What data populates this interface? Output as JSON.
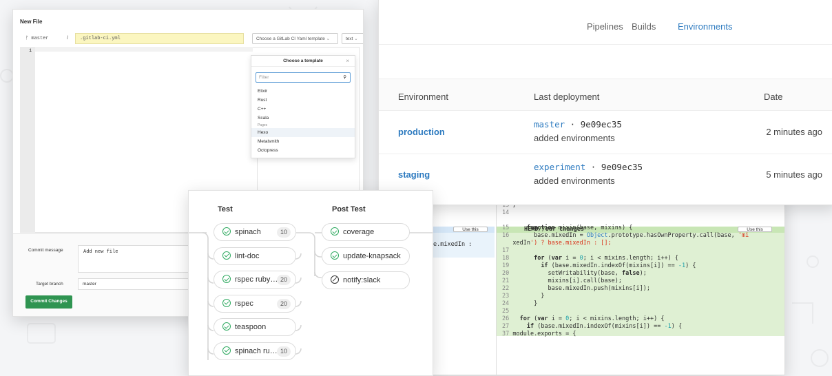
{
  "new_file": {
    "title": "New File",
    "branch": "master",
    "path_sep": "/",
    "file_name": ".gitlab-ci.yml",
    "template_button": "Choose a GitLab CI Yaml template",
    "text_button": "text",
    "line_number": "1",
    "dropdown": {
      "header": "Choose a template",
      "close": "×",
      "filter_placeholder": "Filter",
      "items": [
        "Elixir",
        "Rust",
        "C++",
        "Scala"
      ],
      "group": "Pages",
      "group_items": [
        "Hexo",
        "Metalsmith",
        "Octopress"
      ]
    },
    "commit_message_label": "Commit message",
    "commit_message_value": "Add new file",
    "target_branch_label": "Target branch",
    "target_branch_value": "master",
    "commit_button": "Commit Changes"
  },
  "environments": {
    "nav": [
      "Pipelines",
      "Builds",
      "Environments"
    ],
    "headers": [
      "Environment",
      "Last deployment",
      "Date"
    ],
    "rows": [
      {
        "name": "production",
        "branch": "master",
        "sha": "9e09ec35",
        "message": "added environments",
        "date": "2 minutes ago"
      },
      {
        "name": "staging",
        "branch": "experiment",
        "sha": "9e09ec35",
        "message": "added environments",
        "date": "5 minutes ago"
      }
    ]
  },
  "pipeline": {
    "stages": [
      "Test",
      "Post Test"
    ],
    "test_jobs": [
      {
        "name": "spinach",
        "count": "10"
      },
      {
        "name": "lint-doc",
        "count": ""
      },
      {
        "name": "rspec ruby…",
        "count": "20"
      },
      {
        "name": "rspec",
        "count": "20"
      },
      {
        "name": "teaspoon",
        "count": ""
      },
      {
        "name": "spinach ru…",
        "count": "10"
      }
    ],
    "post_jobs": [
      {
        "name": "coverage",
        "status": "success"
      },
      {
        "name": "update-knapsack",
        "status": "success"
      },
      {
        "name": "notify:slack",
        "status": "skipped"
      }
    ]
  },
  "diff": {
    "use_this": "Use this",
    "head_label": "HEAD//our changes",
    "left_line": "e.mixedIn :",
    "lines": [
      {
        "n": "13",
        "t": "}"
      },
      {
        "n": "14",
        "t": ""
      },
      {
        "n": "15",
        "t": "    function mixin(base, mixins) {"
      },
      {
        "n": "16",
        "t": "      base.mixedIn = Object.prototype.hasOwnProperty.call(base, 'mi"
      },
      {
        "n": "",
        "t": "xedIn') ? base.mixedIn : [];"
      },
      {
        "n": "17",
        "t": ""
      },
      {
        "n": "18",
        "t": "      for (var i = 0; i < mixins.length; i++) {"
      },
      {
        "n": "19",
        "t": "        if (base.mixedIn.indexOf(mixins[i]) == -1) {"
      },
      {
        "n": "20",
        "t": "          setWritability(base, false);"
      },
      {
        "n": "21",
        "t": "          mixins[i].call(base);"
      },
      {
        "n": "22",
        "t": "          base.mixedIn.push(mixins[i]);"
      },
      {
        "n": "23",
        "t": "        }"
      },
      {
        "n": "24",
        "t": "      }"
      },
      {
        "n": "25",
        "t": ""
      },
      {
        "n": "26",
        "t": "  for (var i = 0; i < mixins.length; i++) {"
      },
      {
        "n": "27",
        "t": "    if (base.mixedIn.indexOf(mixins[i]) == -1) {"
      },
      {
        "n": "37",
        "t": "module.exports = {"
      }
    ]
  }
}
